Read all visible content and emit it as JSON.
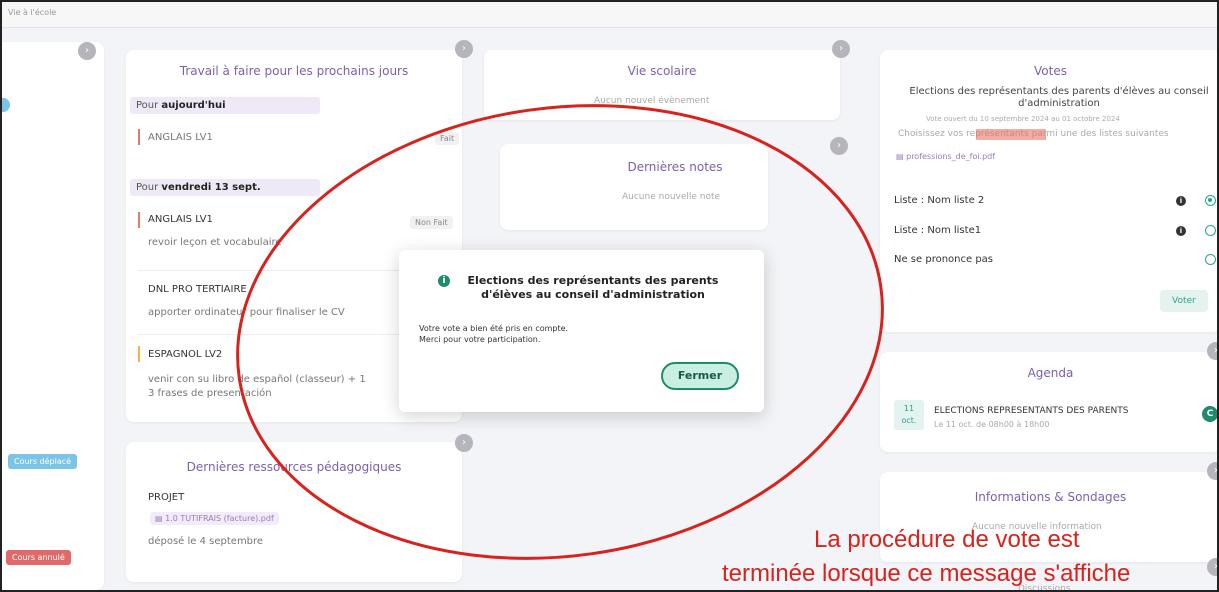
{
  "topbar": {
    "crumb": "Vie à l'école"
  },
  "work": {
    "title": "Travail à faire pour les prochains jours",
    "today_prefix": "Pour ",
    "today_bold": "aujourd'hui",
    "item1": {
      "subject": "ANGLAIS LV1",
      "status": "Fait"
    },
    "friday_prefix": "Pour ",
    "friday_bold": "vendredi 13 sept.",
    "item2": {
      "subject": "ANGLAIS LV1",
      "task": "revoir leçon et vocabulaire",
      "status": "Non Fait"
    },
    "item3": {
      "subject": "DNL PRO TERTIAIRE",
      "task": "apporter ordinateur pour finaliser le CV"
    },
    "item4": {
      "subject": "ESPAGNOL LV2",
      "task": "venir con su libro de español (classeur) + 1",
      "task2": "3 frases de presentación"
    }
  },
  "vie": {
    "title": "Vie scolaire",
    "text": "Aucun nouvel évènement"
  },
  "notes": {
    "title": "Dernières notes",
    "text": "Aucune nouvelle note"
  },
  "resources": {
    "title": "Dernières ressources pédagogiques",
    "subject": "PROJET",
    "file": "1.0 TUTIFRAIS (facture).pdf",
    "date": "déposé le 4 septembre"
  },
  "votes": {
    "title": "Votes",
    "election": "Elections des représentants des parents d'élèves au conseil d'administration",
    "period": "Vote ouvert du 10 septembre 2024 au 01 octobre 2024",
    "instruction": "Choisissez vos représentants parmi une des listes suivantes",
    "file": "professions_de_foi.pdf",
    "options": [
      "Liste : Nom liste 2",
      "Liste : Nom liste1",
      "Ne se prononce pas"
    ],
    "button": "Voter"
  },
  "agenda": {
    "title": "Agenda",
    "day": "11",
    "month": "oct.",
    "event": "ELECTIONS REPRESENTANTS DES PARENTS",
    "when": "Le 11 oct. de 08h00 à 18h00"
  },
  "info": {
    "title": "Informations & Sondages",
    "text": "Aucune nouvelle information"
  },
  "discussions": {
    "title": "Discussions"
  },
  "sidebar": {
    "tag1": "Cours déplacé",
    "tag2": "Cours annulé"
  },
  "modal": {
    "title": "Elections des représentants des parents d'élèves au conseil d'administration",
    "line1": "Votre vote a bien été pris en compte.",
    "line2": "Merci pour votre participation.",
    "button": "Fermer"
  },
  "annotation": {
    "line1": "La procédure de vote est",
    "line2": "terminée lorsque ce message s'affiche",
    "color": "#d8221d"
  }
}
